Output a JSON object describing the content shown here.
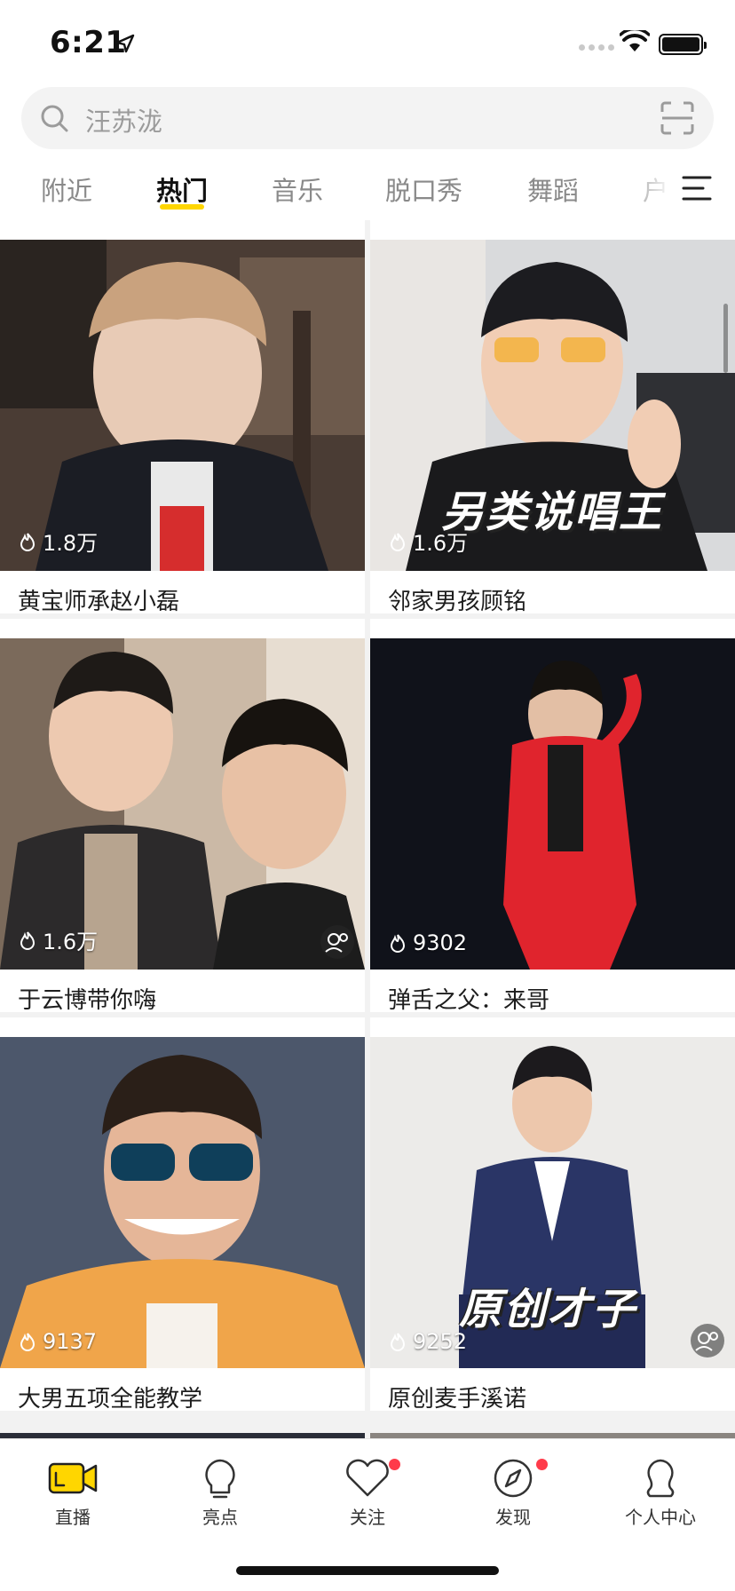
{
  "status_bar": {
    "time": "6:21"
  },
  "search": {
    "placeholder": "汪苏泷"
  },
  "tabs": [
    {
      "label": "附近"
    },
    {
      "label": "热门"
    },
    {
      "label": "音乐"
    },
    {
      "label": "脱口秀"
    },
    {
      "label": "舞蹈"
    },
    {
      "label": "户"
    }
  ],
  "active_tab": "热门",
  "cards": [
    {
      "title": "黄宝师承赵小磊",
      "viewers": "1.8万",
      "overlay": ""
    },
    {
      "title": "邻家男孩顾铭",
      "viewers": "1.6万",
      "overlay": "另类说唱王"
    },
    {
      "title": "于云博带你嗨",
      "viewers": "1.6万",
      "overlay": ""
    },
    {
      "title": "弹舌之父：来哥",
      "viewers": "9302",
      "overlay": ""
    },
    {
      "title": "大男五项全能教学",
      "viewers": "9137",
      "overlay": ""
    },
    {
      "title": "原创麦手溪诺",
      "viewers": "9252",
      "overlay": "原创才子"
    }
  ],
  "bottom_nav": [
    {
      "label": "直播",
      "icon": "live-camera-icon"
    },
    {
      "label": "亮点",
      "icon": "lightbulb-icon"
    },
    {
      "label": "关注",
      "icon": "heart-icon"
    },
    {
      "label": "发现",
      "icon": "compass-icon"
    },
    {
      "label": "个人中心",
      "icon": "profile-icon"
    }
  ],
  "colors": {
    "accent": "#ffd600",
    "badge": "#ff3b4a"
  }
}
